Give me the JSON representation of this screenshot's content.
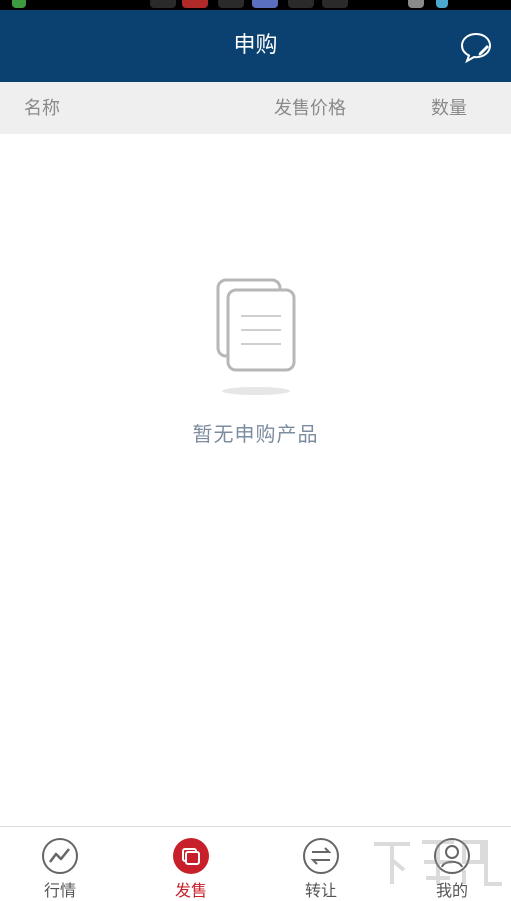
{
  "header": {
    "title": "申购"
  },
  "table_header": {
    "name": "名称",
    "price": "发售价格",
    "quantity": "数量"
  },
  "empty_state": {
    "message": "暂无申购产品"
  },
  "tabs": [
    {
      "label": "行情",
      "icon": "chart-line-icon",
      "active": false
    },
    {
      "label": "发售",
      "icon": "sale-icon",
      "active": true
    },
    {
      "label": "转让",
      "icon": "transfer-icon",
      "active": false
    },
    {
      "label": "我的",
      "icon": "user-icon",
      "active": false
    }
  ],
  "colors": {
    "header_bg": "#0a4170",
    "active_tab": "#c8202a",
    "column_header_bg": "#efefef",
    "empty_text": "#7d8da0"
  }
}
